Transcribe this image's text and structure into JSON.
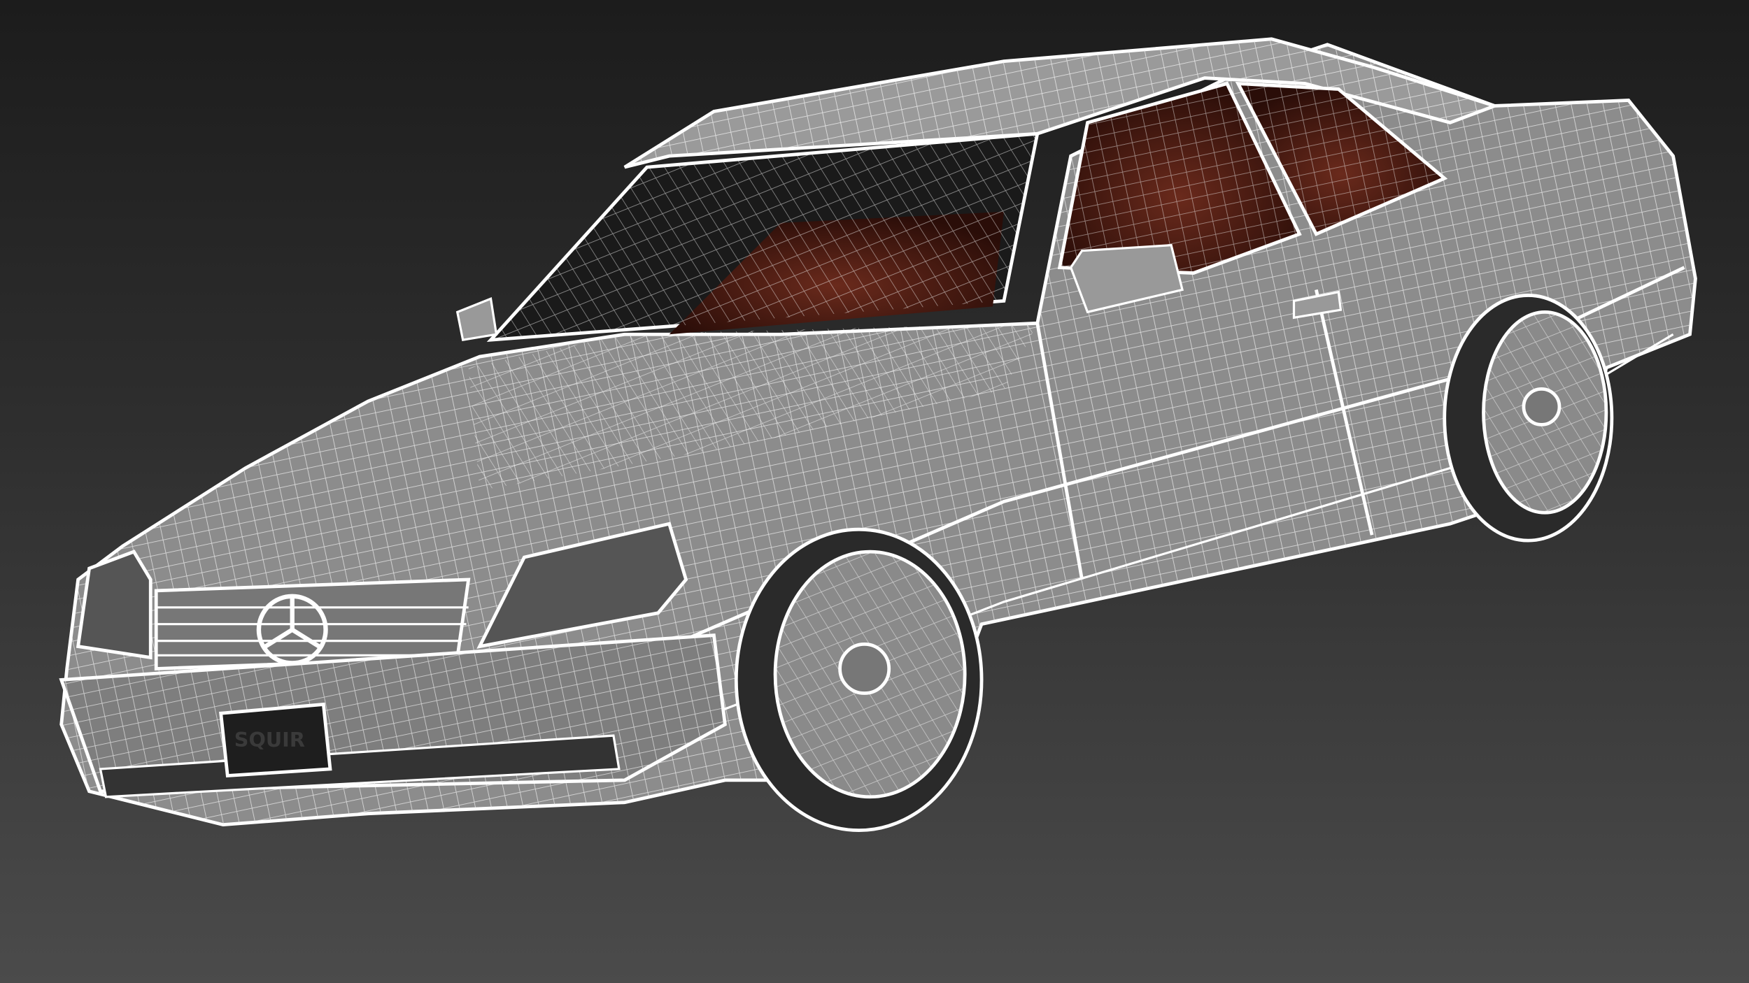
{
  "render": {
    "subject": "wireframe-car",
    "license_plate": {
      "text": "SQUIR"
    },
    "colors": {
      "background_top": "#1c1c1c",
      "background_bottom": "#4b4b4b",
      "body": "#8c8c8c",
      "wire": "#ffffff",
      "interior": "#4a1a12",
      "glass": "#1a1a1a"
    }
  }
}
